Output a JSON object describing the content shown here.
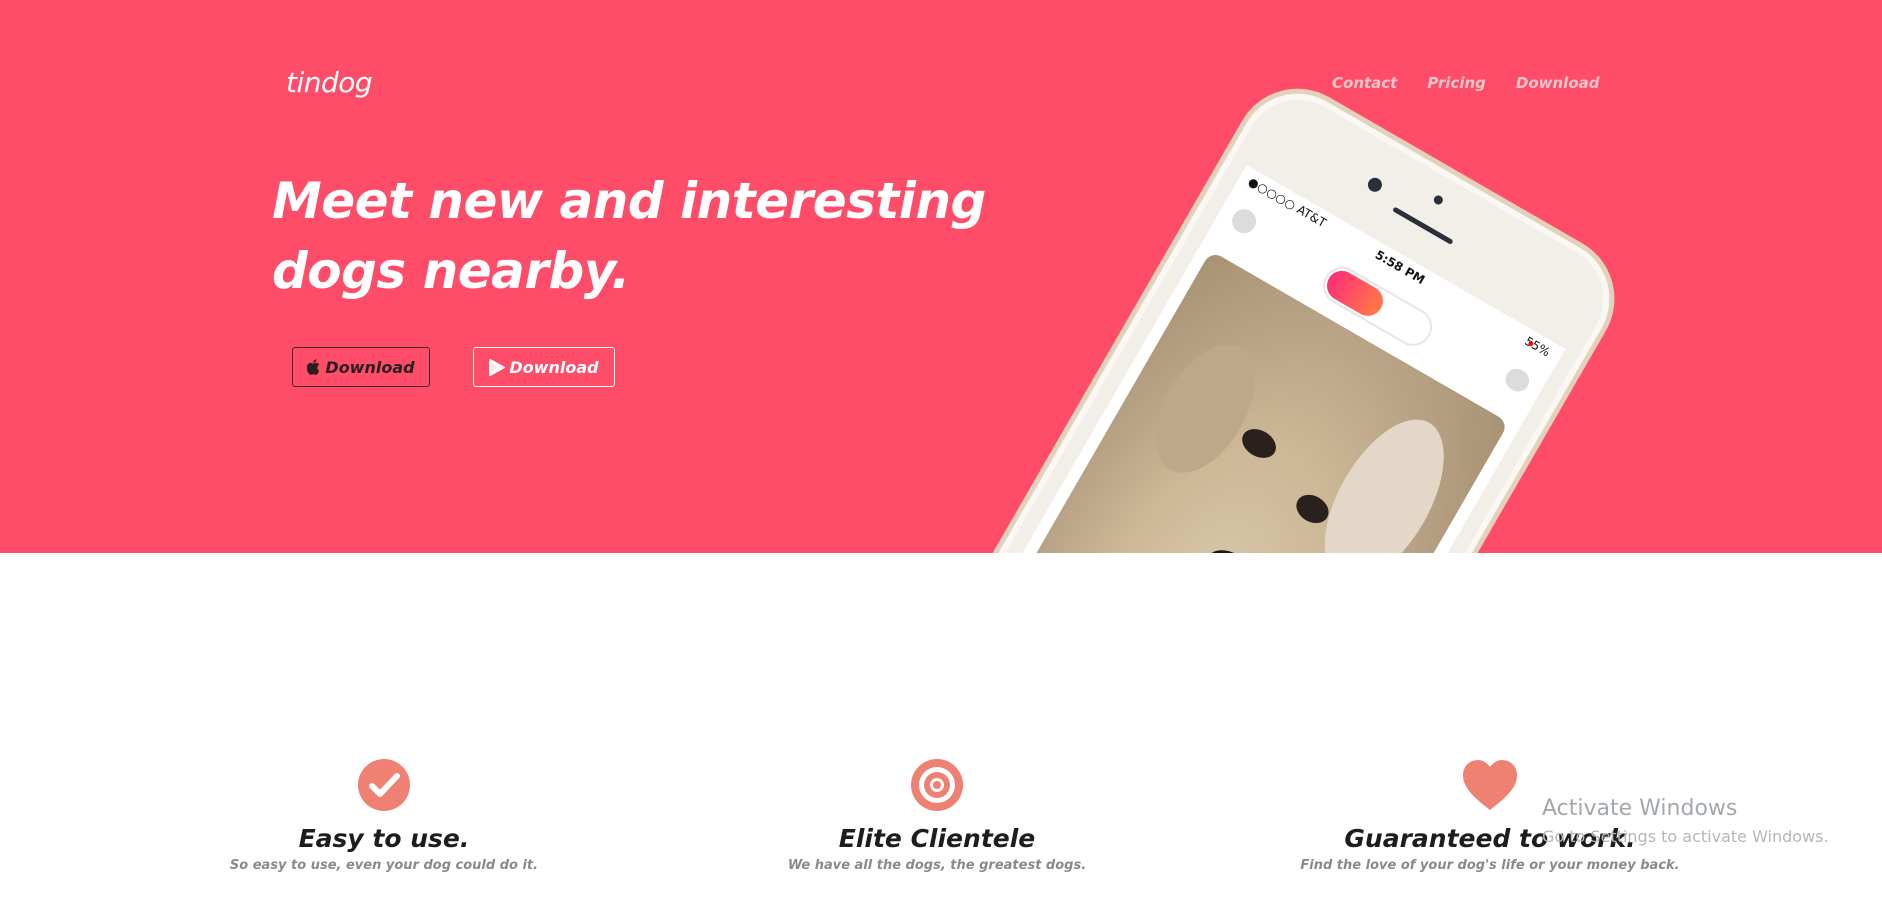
{
  "brand": {
    "name": "tindog"
  },
  "nav": {
    "items": [
      {
        "label": "Contact"
      },
      {
        "label": "Pricing"
      },
      {
        "label": "Download"
      }
    ]
  },
  "hero": {
    "headline": "Meet new and interesting dogs nearby.",
    "background_color": "#ff4c68",
    "buttons": [
      {
        "label": "Download",
        "icon": "apple-icon",
        "style": "dark-outline"
      },
      {
        "label": "Download",
        "icon": "google-play-icon",
        "style": "light-outline"
      }
    ]
  },
  "phone": {
    "carrier": "●○○○○ AT&T",
    "time": "5:58 PM",
    "battery": "55%",
    "accent_gradient": [
      "#ff2d79",
      "#ff7a46"
    ]
  },
  "features": [
    {
      "icon": "check-circle-icon",
      "title": "Easy to use.",
      "description": "So easy to use, even your dog could do it."
    },
    {
      "icon": "bullseye-icon",
      "title": "Elite Clientele",
      "description": "We have all the dogs, the greatest dogs."
    },
    {
      "icon": "heart-icon",
      "title": "Guaranteed to work.",
      "description": "Find the love of your dog's life or your money back."
    }
  ],
  "feature_icon_color": "#ef8172",
  "os_watermark": {
    "line1": "Activate Windows",
    "line2": "Go to Settings to activate Windows."
  }
}
